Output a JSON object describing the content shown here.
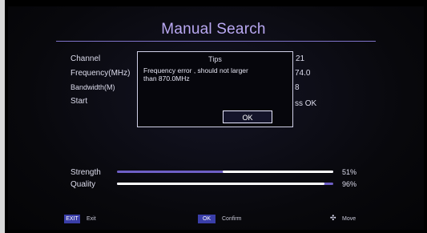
{
  "header": {
    "title": "Manual Search"
  },
  "fields": [
    {
      "label": "Channel",
      "value": "21"
    },
    {
      "label": "Frequency(MHz)",
      "value": "74.0"
    },
    {
      "label": "Bandwidth(M)",
      "value": "8"
    },
    {
      "label": "Start",
      "value": "ss OK"
    }
  ],
  "dialog": {
    "title": "Tips",
    "message_line1": "Frequency error , should not larger",
    "message_line2": "than 870.0MHz",
    "ok_label": "OK"
  },
  "signal": {
    "strength_label": "Strength",
    "strength_percent_text": "51%",
    "strength_fraction": 0.51,
    "quality_label": "Quality",
    "quality_percent_text": "96%",
    "quality_fraction": 0.96
  },
  "footer": {
    "exit_key": "EXIT",
    "exit_label": "Exit",
    "ok_key": "OK",
    "ok_label": "Confirm",
    "move_icon": "move-cross-icon",
    "move_label": "Move"
  },
  "colors": {
    "accent": "#6e5fc6",
    "title": "#b9a8f2",
    "keycap": "#3a3ea8"
  }
}
